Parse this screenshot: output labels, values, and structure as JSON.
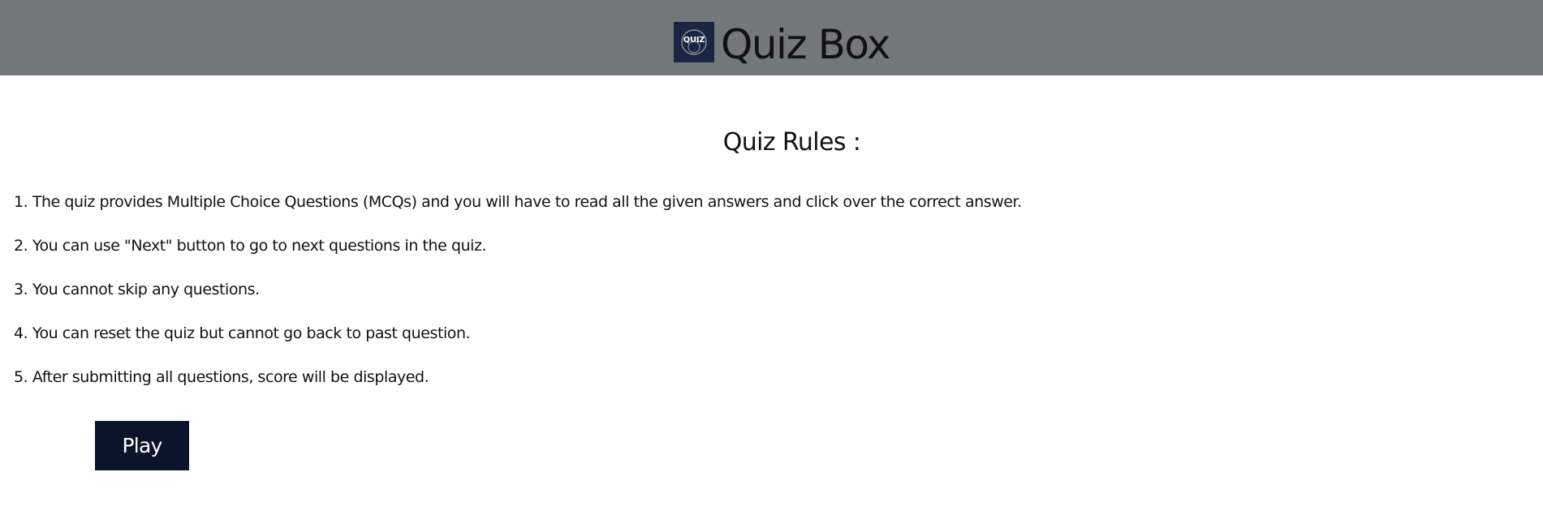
{
  "header": {
    "logo_text": "QUIZ",
    "title": "Quiz Box"
  },
  "rules": {
    "heading": "Quiz Rules :",
    "items": [
      "1. The quiz provides Multiple Choice Questions (MCQs) and you will have to read all the given answers and click over the correct answer.",
      "2. You can use \"Next\" button to go to next questions in the quiz.",
      "3. You cannot skip any questions.",
      "4. You can reset the quiz but cannot go back to past question.",
      "5. After submitting all questions, score will be displayed."
    ]
  },
  "actions": {
    "play_label": "Play"
  },
  "colors": {
    "header_bg": "#73787b",
    "button_bg": "#0b1428",
    "logo_bg": "#1b2440"
  }
}
